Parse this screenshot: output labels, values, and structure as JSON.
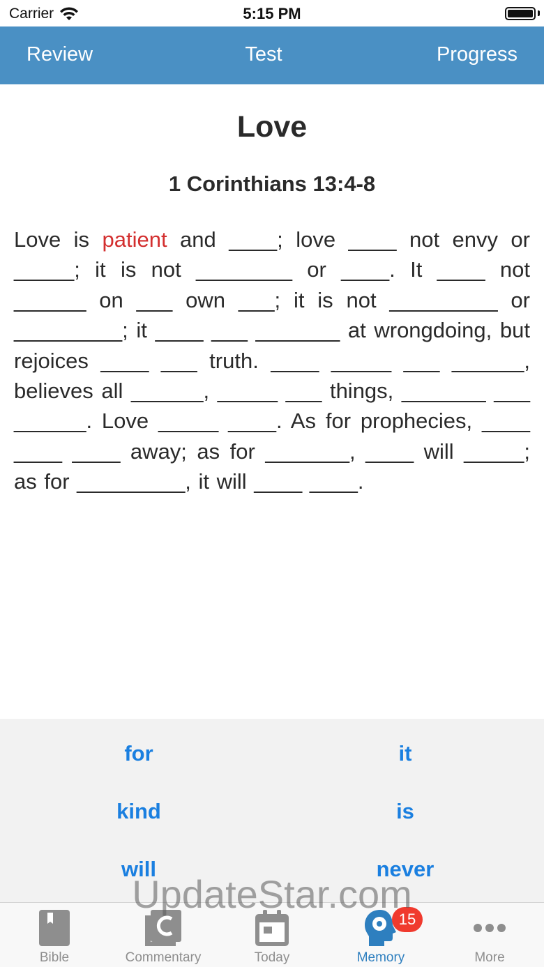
{
  "status_bar": {
    "carrier": "Carrier",
    "time": "5:15 PM"
  },
  "top_tabs": {
    "review": "Review",
    "test": "Test",
    "progress": "Progress"
  },
  "verse": {
    "title": "Love",
    "reference": "1 Corinthians 13:4-8",
    "text_before": "Love is ",
    "highlight": "patient",
    "text_after": " and ____; love ____ not envy or _____; it is not ________ or ____. It ____ not ______ on ___ own ___; it is not _________ or _________; it ____ ___ _______ at wrongdoing, but rejoices ____ ___ truth. ____ _____ ___ ______, believes all ______, _____ ___ things, _______ ___ ______. Love _____ ____. As for prophecies, ____ ____ ____ away; as for _______, ____ will _____; as for _________, it will ____ ____."
  },
  "choices": {
    "r1_left": "for",
    "r1_right": "it",
    "r2_left": "kind",
    "r2_right": "is",
    "r3_left": "will",
    "r3_right": "never"
  },
  "watermark": "UpdateStar.com",
  "bottom_tabs": {
    "bible": "Bible",
    "commentary": "Commentary",
    "today": "Today",
    "memory": "Memory",
    "memory_badge": "15",
    "more": "More"
  },
  "colors": {
    "accent": "#4a90c4",
    "highlight": "#d32f2f",
    "choice": "#1a7fe0",
    "badge": "#f03a2e"
  }
}
